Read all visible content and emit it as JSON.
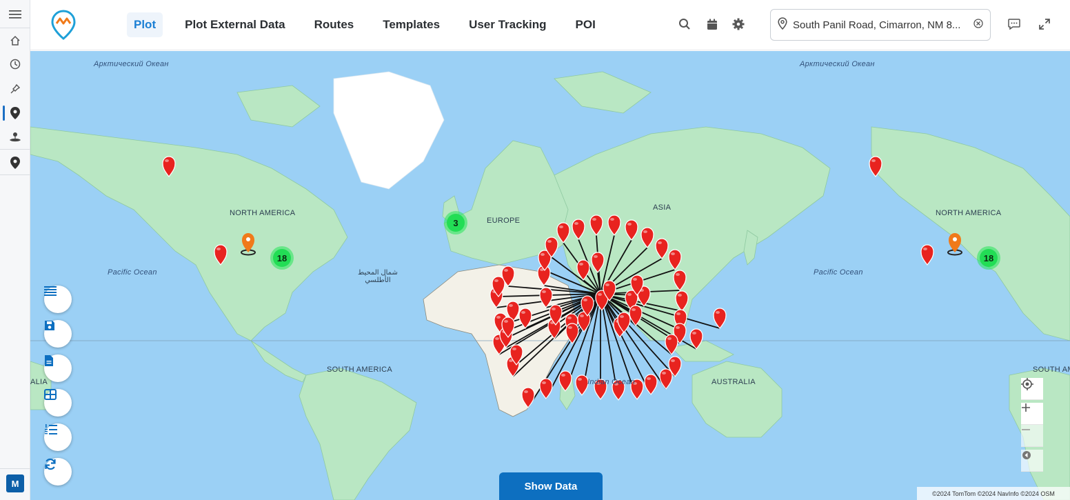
{
  "header": {
    "tabs": [
      {
        "label": "Plot",
        "active": true
      },
      {
        "label": "Plot External Data",
        "active": false
      },
      {
        "label": "Routes",
        "active": false
      },
      {
        "label": "Templates",
        "active": false
      },
      {
        "label": "User Tracking",
        "active": false
      },
      {
        "label": "POI",
        "active": false
      }
    ],
    "search_value": "South Panil Road, Cimarron, NM 8...",
    "icons": [
      "search-icon",
      "calendar-icon",
      "gear-icon",
      "clear-icon",
      "chat-icon",
      "expand-icon"
    ]
  },
  "rail": {
    "icons": [
      "menu-icon",
      "home-icon",
      "history-icon",
      "pin-icon",
      "location-icon",
      "route-icon",
      "marker-icon"
    ],
    "avatar": "M"
  },
  "map": {
    "labels": {
      "arctic_left": "Арктический Океан",
      "arctic_right": "Арктический Океан",
      "north_america_left": "NORTH AMERICA",
      "north_america_right": "NORTH AMERICA",
      "pacific_left": "Pacific Ocean",
      "pacific_right": "Pacific Ocean",
      "atlantic_line1": "شمال المحيط",
      "atlantic_line2": "الأطلسي",
      "europe": "EUROPE",
      "asia": "ASIA",
      "south_america_left": "SOUTH AMERICA",
      "south_america_right": "SOUTH AMERICA",
      "indian_ocean": "Indian Ocean",
      "australia": "AUSTRALIA",
      "edge_label": "ALIA"
    },
    "clusters": {
      "europe": "3",
      "us_left": "18",
      "us_right": "18"
    },
    "show_data_label": "Show Data",
    "attribution": "©2024 TomTom ©2024 NavInfo ©2024 OSM",
    "colors": {
      "water": "#9bd0f5",
      "land": "#b9e7c3",
      "marker": "#e8231f",
      "cluster": "#22dd55",
      "orange_marker": "#f07a1a",
      "primary": "#0d6fc0"
    }
  },
  "tools": [
    "list-icon",
    "save-icon",
    "document-icon",
    "grid-icon",
    "ordered-list-icon",
    "refresh-icon"
  ],
  "controls": [
    "locate-icon",
    "zoom-in-icon",
    "zoom-out-icon",
    "compass-icon"
  ]
}
